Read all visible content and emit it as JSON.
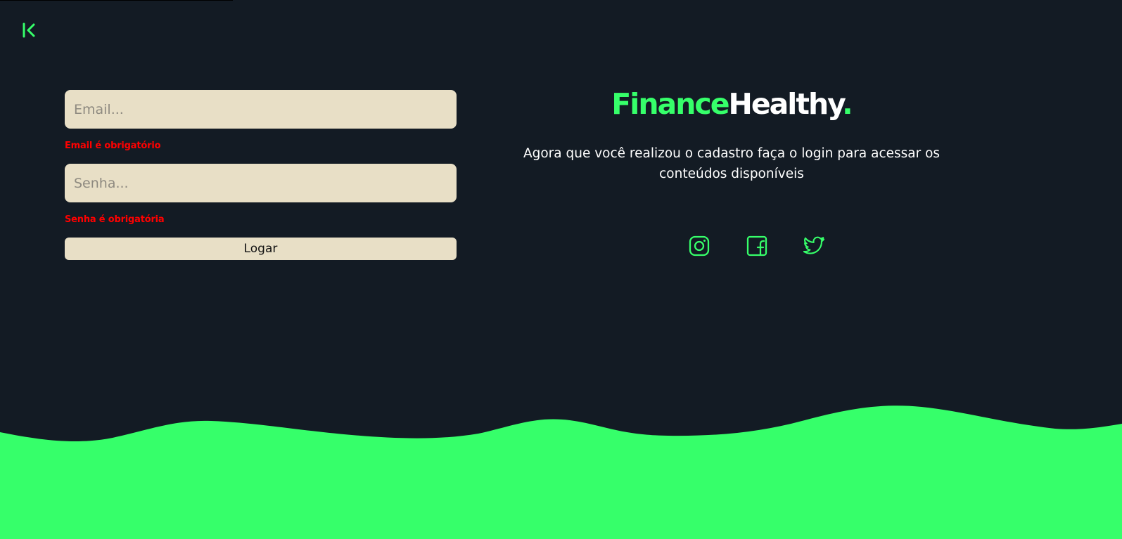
{
  "colors": {
    "background": "#131b24",
    "accent": "#36ff6a",
    "field": "#e8dfc6",
    "error": "#ff0000"
  },
  "nav": {
    "back_icon": "chevron-left-bar-icon"
  },
  "form": {
    "email": {
      "placeholder": "Email...",
      "value": "",
      "error": "Email é obrigatório"
    },
    "password": {
      "placeholder": "Senha...",
      "value": "",
      "error": "Senha é obrigatória"
    },
    "submit_label": "Logar"
  },
  "brand": {
    "part1": "Finance",
    "part2": "Healthy",
    "dot": "."
  },
  "tagline": "Agora que você realizou o cadastro faça o login para acessar os conteúdos disponíveis",
  "socials": [
    {
      "icon": "instagram-icon"
    },
    {
      "icon": "facebook-icon"
    },
    {
      "icon": "twitter-icon"
    }
  ]
}
